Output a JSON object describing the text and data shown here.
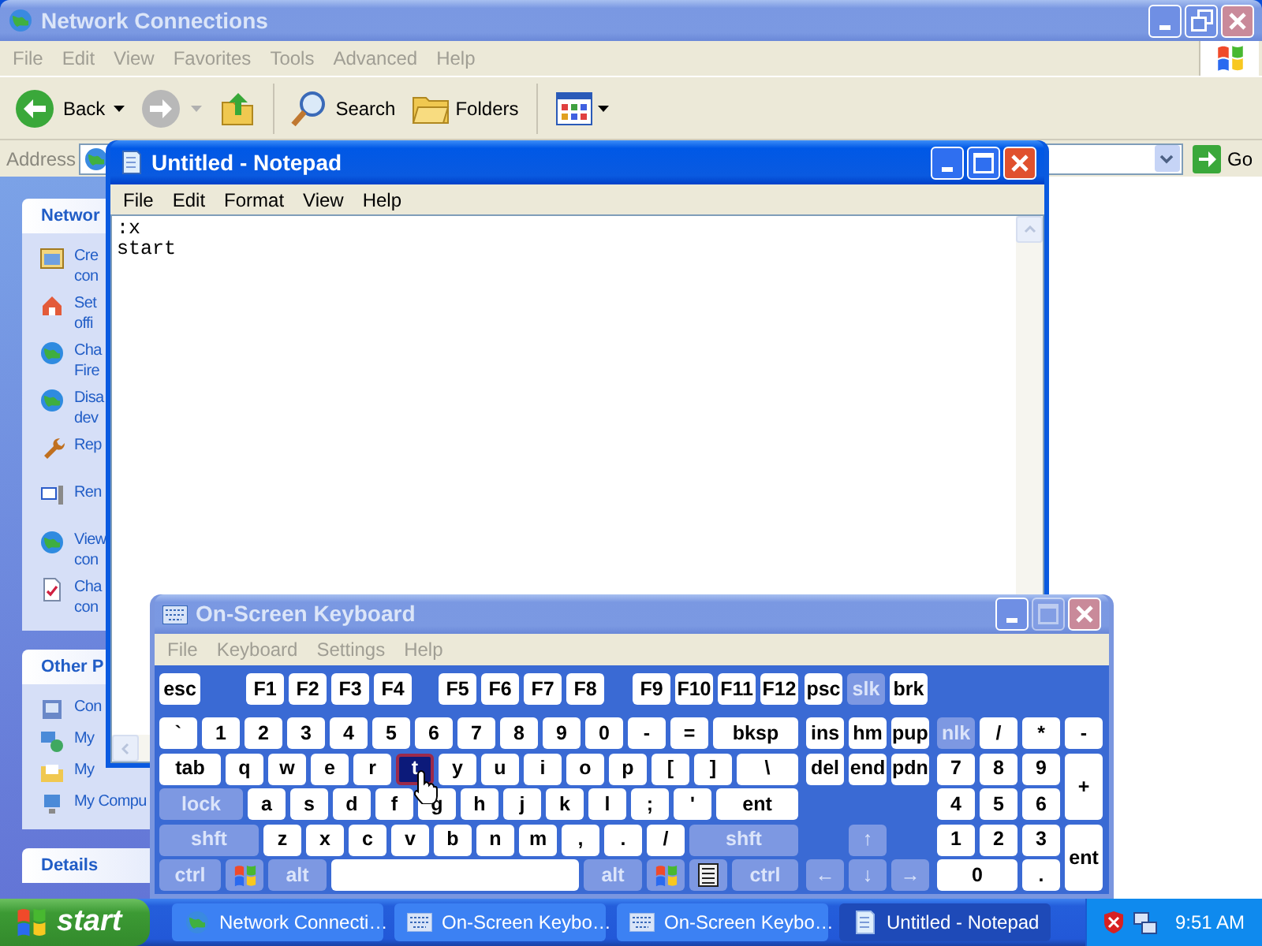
{
  "explorer": {
    "title": "Network Connections",
    "active": false,
    "buttons": [
      {
        "kind": "minimize",
        "disabled": false
      },
      {
        "kind": "restore",
        "disabled": false
      },
      {
        "kind": "close",
        "disabled": false
      }
    ],
    "menu": [
      "File",
      "Edit",
      "View",
      "Favorites",
      "Tools",
      "Advanced",
      "Help"
    ],
    "toolbar": {
      "back": {
        "label": "Back",
        "disabled": false
      },
      "forward": {
        "disabled": true
      },
      "search": "Search",
      "folders": "Folders"
    },
    "address_label": "Address",
    "go": "Go",
    "panes": [
      {
        "title": "Networ",
        "items": [
          {
            "lines": [
              "Cre",
              "con"
            ]
          },
          {
            "lines": [
              "Set",
              "offi"
            ]
          },
          {
            "lines": [
              "Cha",
              "Fire"
            ]
          },
          {
            "lines": [
              "Disa",
              "dev"
            ]
          },
          {
            "lines": [
              "Rep"
            ]
          },
          {
            "lines": [
              "Ren"
            ]
          },
          {
            "lines": [
              "View",
              "con"
            ]
          },
          {
            "lines": [
              "Cha",
              "con"
            ]
          }
        ]
      },
      {
        "title": "Other P",
        "items": [
          {
            "lines": [
              "Con"
            ]
          },
          {
            "lines": [
              "My"
            ]
          },
          {
            "lines": [
              "My"
            ]
          },
          {
            "lines": [
              "My Compu"
            ]
          }
        ]
      },
      {
        "title": "Details"
      }
    ]
  },
  "notepad": {
    "title": "Untitled - Notepad",
    "active": true,
    "buttons": [
      {
        "kind": "minimize",
        "disabled": false
      },
      {
        "kind": "maximize",
        "disabled": false
      },
      {
        "kind": "close",
        "disabled": false
      }
    ],
    "menu": [
      "File",
      "Edit",
      "Format",
      "View",
      "Help"
    ],
    "lines": [
      ":x",
      "start"
    ]
  },
  "keyboard": {
    "title": "On-Screen Keyboard",
    "active": false,
    "buttons": [
      {
        "kind": "minimize",
        "disabled": false
      },
      {
        "kind": "maximize",
        "disabled": true
      },
      {
        "kind": "close",
        "disabled": false
      }
    ],
    "menu": [
      "File",
      "Keyboard",
      "Settings",
      "Help"
    ],
    "function_row": [
      [
        {
          "label": "esc",
          "kind": "key"
        }
      ],
      [
        {
          "label": "F1",
          "kind": "key"
        },
        {
          "label": "F2",
          "kind": "key"
        },
        {
          "label": "F3",
          "kind": "key"
        },
        {
          "label": "F4",
          "kind": "key"
        }
      ],
      [
        {
          "label": "F5",
          "kind": "key"
        },
        {
          "label": "F6",
          "kind": "key"
        },
        {
          "label": "F7",
          "kind": "key"
        },
        {
          "label": "F8",
          "kind": "key"
        }
      ],
      [
        {
          "label": "F9",
          "kind": "key"
        },
        {
          "label": "F10",
          "kind": "key"
        },
        {
          "label": "F11",
          "kind": "key"
        },
        {
          "label": "F12",
          "kind": "key"
        }
      ],
      [
        {
          "label": "psc",
          "kind": "key"
        },
        {
          "label": "slk",
          "kind": "dim"
        },
        {
          "label": "brk",
          "kind": "key"
        }
      ]
    ],
    "main": [
      [
        {
          "label": "`",
          "kind": "key",
          "hot": false
        },
        {
          "label": "1",
          "kind": "key",
          "hot": false
        },
        {
          "label": "2",
          "kind": "key",
          "hot": false
        },
        {
          "label": "3",
          "kind": "key",
          "hot": false
        },
        {
          "label": "4",
          "kind": "key",
          "hot": false
        },
        {
          "label": "5",
          "kind": "key",
          "hot": false
        },
        {
          "label": "6",
          "kind": "key",
          "hot": false
        },
        {
          "label": "7",
          "kind": "key",
          "hot": false
        },
        {
          "label": "8",
          "kind": "key",
          "hot": false
        },
        {
          "label": "9",
          "kind": "key",
          "hot": false
        },
        {
          "label": "0",
          "kind": "key",
          "hot": false
        },
        {
          "label": "-",
          "kind": "key",
          "hot": false
        },
        {
          "label": "=",
          "kind": "key",
          "hot": false
        },
        {
          "label": "bksp",
          "kind": "key",
          "hot": false
        }
      ],
      [
        {
          "label": "tab",
          "kind": "key",
          "hot": false
        },
        {
          "label": "q",
          "kind": "key",
          "hot": false
        },
        {
          "label": "w",
          "kind": "key",
          "hot": false
        },
        {
          "label": "e",
          "kind": "key",
          "hot": false
        },
        {
          "label": "r",
          "kind": "key",
          "hot": false
        },
        {
          "label": "t",
          "kind": "key",
          "hot": true
        },
        {
          "label": "y",
          "kind": "key",
          "hot": false
        },
        {
          "label": "u",
          "kind": "key",
          "hot": false
        },
        {
          "label": "i",
          "kind": "key",
          "hot": false
        },
        {
          "label": "o",
          "kind": "key",
          "hot": false
        },
        {
          "label": "p",
          "kind": "key",
          "hot": false
        },
        {
          "label": "[",
          "kind": "key",
          "hot": false
        },
        {
          "label": "]",
          "kind": "key",
          "hot": false
        },
        {
          "label": "\\",
          "kind": "key",
          "hot": false
        }
      ],
      [
        {
          "label": "lock",
          "kind": "dim",
          "hot": false
        },
        {
          "label": "a",
          "kind": "key",
          "hot": false
        },
        {
          "label": "s",
          "kind": "key",
          "hot": false
        },
        {
          "label": "d",
          "kind": "key",
          "hot": false
        },
        {
          "label": "f",
          "kind": "key",
          "hot": false
        },
        {
          "label": "g",
          "kind": "key",
          "hot": false
        },
        {
          "label": "h",
          "kind": "key",
          "hot": false
        },
        {
          "label": "j",
          "kind": "key",
          "hot": false
        },
        {
          "label": "k",
          "kind": "key",
          "hot": false
        },
        {
          "label": "l",
          "kind": "key",
          "hot": false
        },
        {
          "label": ";",
          "kind": "key",
          "hot": false
        },
        {
          "label": "'",
          "kind": "key",
          "hot": false
        },
        {
          "label": "ent",
          "kind": "key",
          "hot": false
        }
      ],
      [
        {
          "label": "shft",
          "kind": "dim",
          "hot": false
        },
        {
          "label": "z",
          "kind": "key",
          "hot": false
        },
        {
          "label": "x",
          "kind": "key",
          "hot": false
        },
        {
          "label": "c",
          "kind": "key",
          "hot": false
        },
        {
          "label": "v",
          "kind": "key",
          "hot": false
        },
        {
          "label": "b",
          "kind": "key",
          "hot": false
        },
        {
          "label": "n",
          "kind": "key",
          "hot": false
        },
        {
          "label": "m",
          "kind": "key",
          "hot": false
        },
        {
          "label": ",",
          "kind": "key",
          "hot": false
        },
        {
          "label": ".",
          "kind": "key",
          "hot": false
        },
        {
          "label": "/",
          "kind": "key",
          "hot": false
        },
        {
          "label": "shft",
          "kind": "dim",
          "hot": false
        }
      ],
      [
        {
          "label": "ctrl",
          "kind": "dim",
          "hot": false
        },
        {
          "kind": "logo",
          "hot": false
        },
        {
          "label": "alt",
          "kind": "dim",
          "hot": false
        },
        {
          "kind": "blank",
          "hot": false
        },
        {
          "label": "alt",
          "kind": "dim",
          "hot": false
        },
        {
          "kind": "logo",
          "hot": false
        },
        {
          "kind": "menu",
          "hot": false
        },
        {
          "label": "ctrl",
          "kind": "dim",
          "hot": false
        }
      ]
    ],
    "nav": {
      "upper": [
        [
          {
            "label": "ins",
            "kind": "key"
          },
          {
            "label": "hm",
            "kind": "key"
          },
          {
            "label": "pup",
            "kind": "key"
          }
        ],
        [
          {
            "label": "del",
            "kind": "key"
          },
          {
            "label": "end",
            "kind": "key"
          },
          {
            "label": "pdn",
            "kind": "key"
          }
        ]
      ],
      "arrows": [
        [
          {
            "label": "↑",
            "kind": "dim"
          }
        ],
        [
          {
            "label": "←",
            "kind": "dim"
          },
          {
            "label": "↓",
            "kind": "dim"
          },
          {
            "label": "→",
            "kind": "dim"
          }
        ]
      ]
    },
    "numpad": [
      {
        "label": "nlk",
        "kind": "dim"
      },
      {
        "label": "/",
        "kind": "key"
      },
      {
        "label": "*",
        "kind": "key"
      },
      {
        "label": "-",
        "kind": "key"
      },
      {
        "label": "7",
        "kind": "key"
      },
      {
        "label": "8",
        "kind": "key"
      },
      {
        "label": "9",
        "kind": "key"
      },
      {
        "label": "+",
        "kind": "key"
      },
      {
        "label": "4",
        "kind": "key"
      },
      {
        "label": "5",
        "kind": "key"
      },
      {
        "label": "6",
        "kind": "key"
      },
      {
        "label": "1",
        "kind": "key"
      },
      {
        "label": "2",
        "kind": "key"
      },
      {
        "label": "3",
        "kind": "key"
      },
      {
        "label": "ent",
        "kind": "key"
      },
      {
        "label": "0",
        "kind": "key"
      },
      {
        "label": ".",
        "kind": "key"
      }
    ]
  },
  "taskbar": {
    "start": "start",
    "tasks": [
      {
        "label": "Network Connecti…",
        "selected": false
      },
      {
        "label": "On-Screen Keybo…",
        "selected": false
      },
      {
        "label": "On-Screen Keybo…",
        "selected": false
      },
      {
        "label": "Untitled - Notepad",
        "selected": true
      }
    ],
    "clock": "9:51 AM"
  }
}
